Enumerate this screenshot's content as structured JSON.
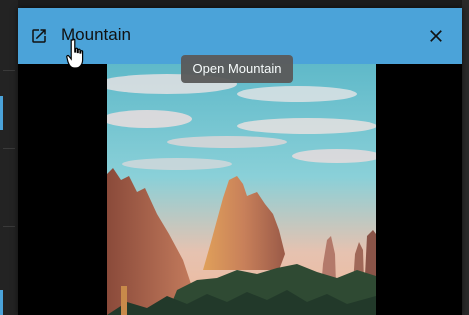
{
  "dialog": {
    "title": "Mountain",
    "open_icon": "open-in-new-icon",
    "close_icon": "close-icon",
    "tooltip": "Open Mountain",
    "image_subject": "mountain-rock-formation-photo"
  },
  "colors": {
    "titlebar": "#4ba3d9",
    "image_background": "#000000",
    "tooltip_background": "#5a5a5a"
  }
}
